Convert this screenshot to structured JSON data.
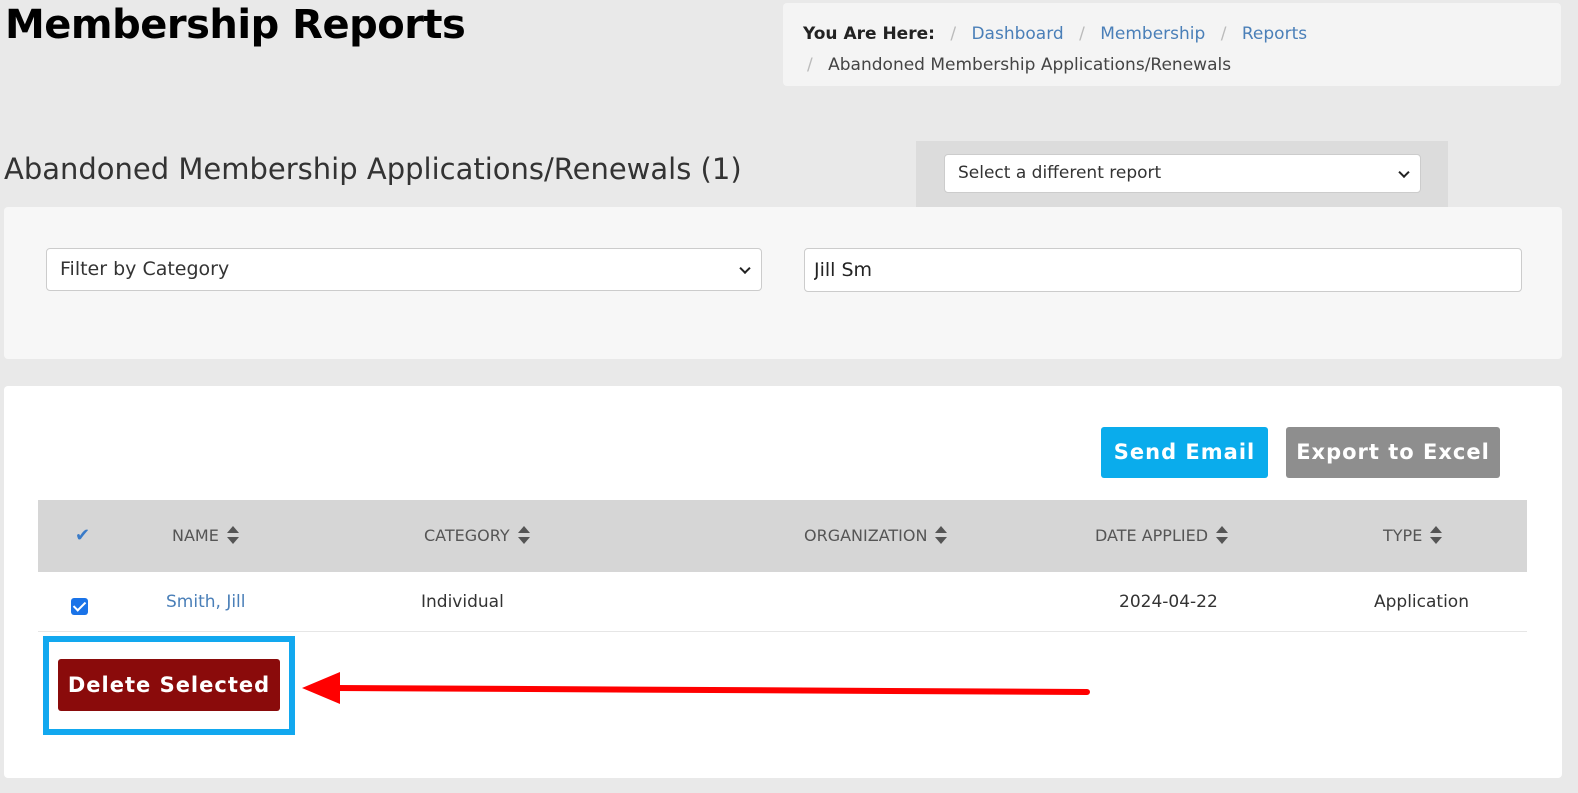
{
  "page": {
    "title": "Membership Reports"
  },
  "breadcrumb": {
    "label": "You Are Here:",
    "separator": "/",
    "links": [
      "Dashboard",
      "Membership",
      "Reports"
    ],
    "current": "Abandoned Membership Applications/Renewals"
  },
  "report": {
    "heading": "Abandoned Membership Applications/Renewals (1)",
    "select_label": "Select a different report"
  },
  "filters": {
    "category_label": "Filter by Category",
    "search_value": "Jill Sm"
  },
  "actions": {
    "send_email": "Send Email",
    "export_excel": "Export to Excel",
    "delete_selected": "Delete Selected"
  },
  "table": {
    "columns": [
      "NAME",
      "CATEGORY",
      "ORGANIZATION",
      "DATE APPLIED",
      "TYPE"
    ],
    "rows": [
      {
        "selected": true,
        "name": "Smith, Jill",
        "category": "Individual",
        "organization": "",
        "date_applied": "2024-04-22",
        "type": "Application"
      }
    ]
  },
  "colors": {
    "send_email": "#0aacec",
    "export_excel": "#8e8e8e",
    "delete_selected": "#8a0b0b",
    "highlight": "#12a8ef",
    "annotation_arrow": "#ff0000",
    "link": "#4a7fb8"
  },
  "icons": {
    "select_all": "check-icon",
    "sort": "sort-icon",
    "dropdown": "chevron-down-icon",
    "annotation": "arrow-left-icon"
  }
}
